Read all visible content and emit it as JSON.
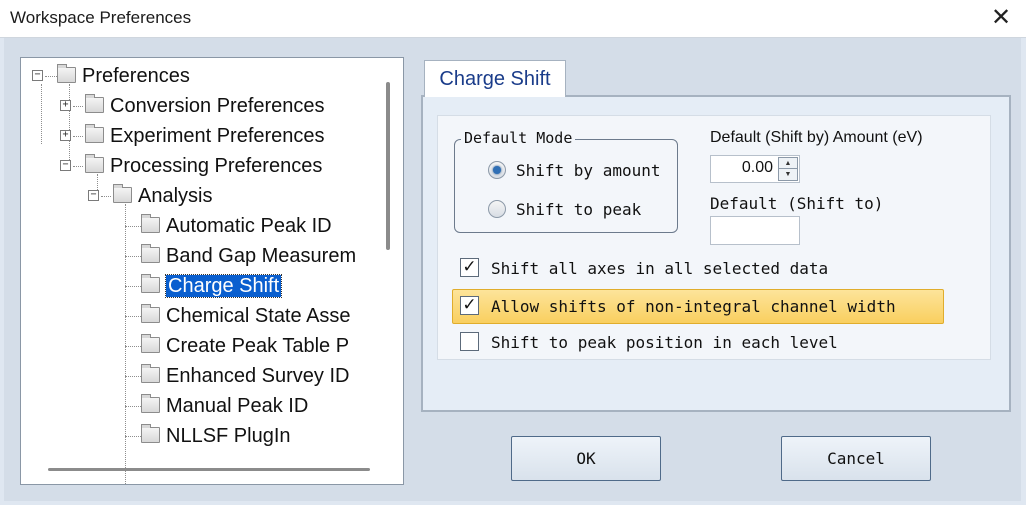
{
  "window": {
    "title": "Workspace Preferences",
    "close_glyph": "✕"
  },
  "tree": {
    "items": [
      {
        "label": "Preferences",
        "expander": "−"
      },
      {
        "label": "Conversion Preferences",
        "expander": "+"
      },
      {
        "label": "Experiment Preferences",
        "expander": "+"
      },
      {
        "label": "Processing Preferences",
        "expander": "−"
      },
      {
        "label": "Analysis",
        "expander": "−"
      },
      {
        "label": "Automatic Peak ID"
      },
      {
        "label": "Band Gap Measurem"
      },
      {
        "label": "Charge Shift",
        "selected": true
      },
      {
        "label": "Chemical State Asse"
      },
      {
        "label": "Create Peak Table P"
      },
      {
        "label": "Enhanced Survey ID"
      },
      {
        "label": "Manual Peak ID"
      },
      {
        "label": "NLLSF PlugIn"
      }
    ]
  },
  "tab": {
    "label": "Charge Shift"
  },
  "default_mode": {
    "title": "Default Mode",
    "options": [
      {
        "label": "Shift by amount",
        "selected": true
      },
      {
        "label": "Shift to peak",
        "selected": false
      }
    ]
  },
  "amount": {
    "label": "Default (Shift by) Amount (eV)",
    "value": "0.00",
    "up_glyph": "▲",
    "down_glyph": "▼"
  },
  "shift_to": {
    "label": "Default (Shift to)",
    "value": ""
  },
  "checks": [
    {
      "label": "Shift all axes in all selected data",
      "checked": true,
      "glyph": "✓"
    },
    {
      "label": "Allow shifts of non-integral channel width",
      "checked": true,
      "glyph": "✓",
      "highlighted": true
    },
    {
      "label": "Shift to peak position in each level",
      "checked": false,
      "glyph": ""
    }
  ],
  "buttons": {
    "ok": "OK",
    "cancel": "Cancel"
  },
  "colors": {
    "selection": "#0a5fcf",
    "highlight": "#f9cf5f",
    "tab_text": "#1a3c8a"
  }
}
